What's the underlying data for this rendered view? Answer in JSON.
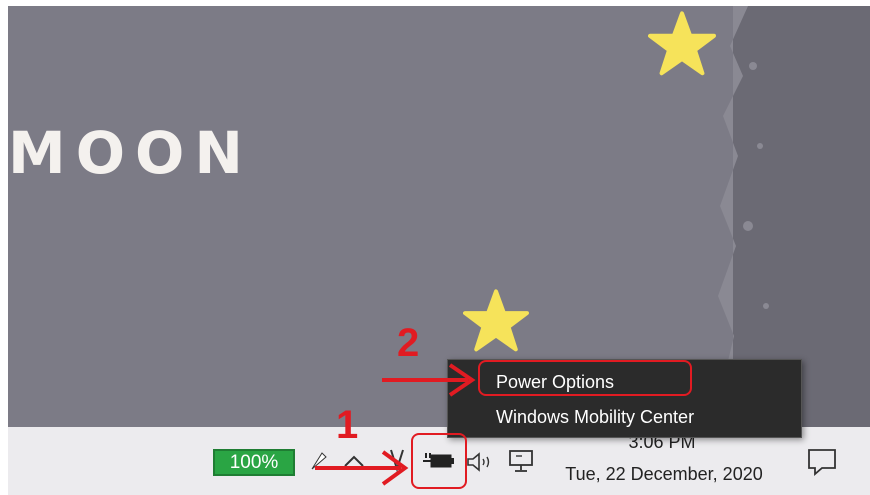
{
  "desktop": {
    "title_text": "MOON"
  },
  "taskbar": {
    "battery_percent": "100%",
    "clock_time": "3:06 PM",
    "clock_date": "Tue, 22 December, 2020",
    "icons": [
      "battery-icon",
      "chevron-up-icon",
      "power-plug-icon",
      "speaker-icon",
      "network-icon",
      "notification-icon"
    ]
  },
  "context_menu": {
    "items": [
      "Power Options",
      "Windows Mobility Center"
    ]
  },
  "annotations": {
    "step_1": "1",
    "step_2": "2"
  },
  "colors": {
    "desktop_bg": "#7c7b86",
    "annotation_red": "#e11b22",
    "battery_green": "#2aa544",
    "menu_bg": "#2b2b2b",
    "star_yellow": "#f6e35a"
  }
}
